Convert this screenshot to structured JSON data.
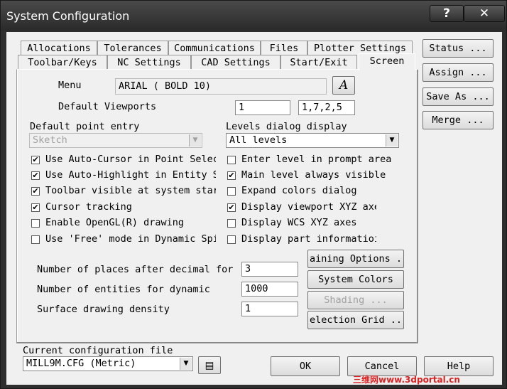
{
  "window": {
    "title": "System Configuration",
    "help_btn": "?",
    "close_btn": "✕"
  },
  "tabs_row1": [
    "Allocations",
    "Tolerances",
    "Communications",
    "Files",
    "Plotter Settings"
  ],
  "tabs_row2": [
    "Toolbar/Keys",
    "NC Settings",
    "CAD Settings",
    "Start/Exit",
    "Screen"
  ],
  "screen": {
    "menu_label": "Menu",
    "menu_value": "ARIAL ( BOLD 10)",
    "font_btn": "A",
    "viewports_label": "Default Viewports",
    "viewports_value1": "1",
    "viewports_value2": "1,7,2,5",
    "point_entry_label": "Default point entry",
    "point_entry_value": "Sketch",
    "levels_label": "Levels dialog display",
    "levels_value": "All levels",
    "checks_left": [
      {
        "label": "Use Auto-Cursor in Point Selec",
        "checked": true
      },
      {
        "label": "Use Auto-Highlight in Entity S",
        "checked": true
      },
      {
        "label": "Toolbar visible at system star",
        "checked": true
      },
      {
        "label": "Cursor tracking",
        "checked": true
      },
      {
        "label": "Enable OpenGL(R) drawing",
        "checked": false
      },
      {
        "label": "Use 'Free' mode in Dynamic Spi",
        "checked": false
      }
    ],
    "checks_right": [
      {
        "label": "Enter level in prompt area",
        "checked": false
      },
      {
        "label": "Main level always visible",
        "checked": true
      },
      {
        "label": "Expand colors dialog",
        "checked": false
      },
      {
        "label": "Display viewport XYZ axe",
        "checked": true
      },
      {
        "label": "Display WCS XYZ axes",
        "checked": false
      },
      {
        "label": "Display part informatioi",
        "checked": false
      }
    ],
    "decimal_label": "Number of places after decimal for",
    "decimal_value": "3",
    "entities_label": "Number of entities for dynamic",
    "entities_value": "1000",
    "density_label": "Surface drawing density",
    "density_value": "1",
    "training_btn": "aining Options .",
    "colors_btn": "System Colors ...",
    "shading_btn": "Shading ...",
    "grid_btn": "election Grid .."
  },
  "side_buttons": {
    "status": "Status ...",
    "assign": "Assign ...",
    "save_as": "Save As ...",
    "merge": "Merge ..."
  },
  "footer": {
    "config_label": "Current configuration file",
    "config_value": "MILL9M.CFG (Metric)",
    "ok": "OK",
    "cancel": "Cancel",
    "help": "Help"
  },
  "watermark": "三维网www.3dportal.cn"
}
